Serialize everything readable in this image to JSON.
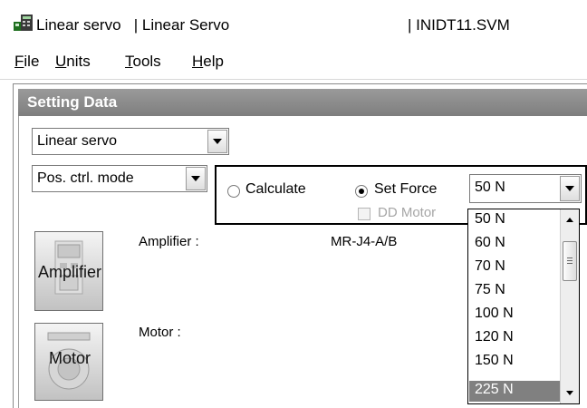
{
  "window": {
    "title_left": "Linear servo   | Linear Servo",
    "title_right": "| INIDT11.SVM"
  },
  "menu": [
    "File",
    "Units",
    "Tools",
    "Help"
  ],
  "section": {
    "title": "Setting Data"
  },
  "servo_type": {
    "selected": "Linear servo"
  },
  "control_mode": {
    "selected": "Pos. ctrl. mode"
  },
  "force": {
    "calculate_label": "Calculate",
    "set_force_label": "Set Force",
    "selected_value": "50 N",
    "dd_motor_label": "DD Motor",
    "options": [
      "50 N",
      "60 N",
      "70 N",
      "75 N",
      "100 N",
      "120 N",
      "150 N",
      "225 N"
    ],
    "highlighted": "225 N"
  },
  "amplifier": {
    "button_label": "Amplifier",
    "field_label": "Amplifier :",
    "value": "MR-J4-A/B"
  },
  "motor": {
    "button_label": "Motor",
    "field_label": "Motor :"
  }
}
